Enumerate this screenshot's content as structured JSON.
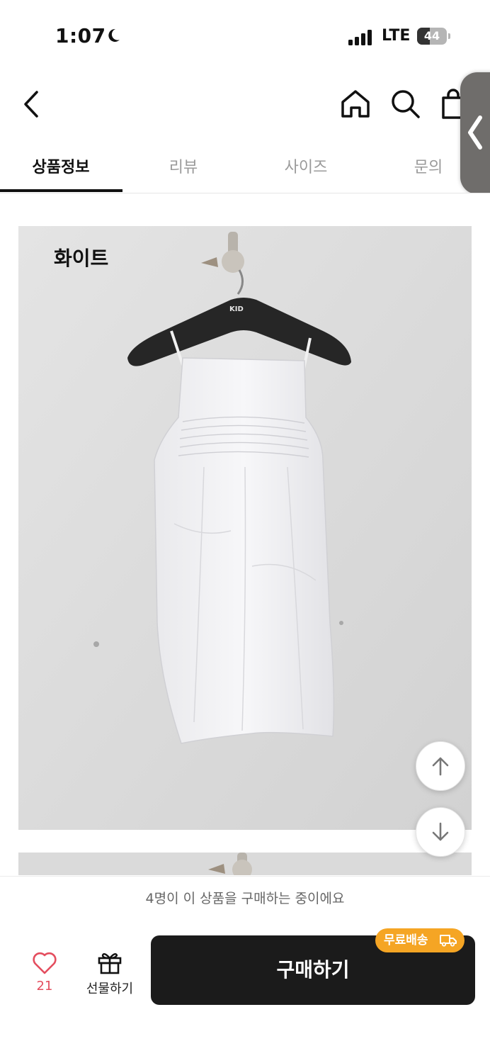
{
  "status_bar": {
    "time": "1:07",
    "network": "LTE",
    "battery": "44",
    "battery_level": 0.44
  },
  "nav": {
    "icons": [
      "back-icon",
      "home-icon",
      "search-icon",
      "shopping-bag-icon"
    ]
  },
  "side_handle": {
    "icon": "chevron-left-icon"
  },
  "tabs": [
    {
      "label": "상품정보",
      "active": true
    },
    {
      "label": "리뷰",
      "active": false
    },
    {
      "label": "사이즈",
      "active": false
    },
    {
      "label": "문의",
      "active": false
    }
  ],
  "product_images": [
    {
      "label": "화이트",
      "hanger_brand": "KID"
    }
  ],
  "scroll_buttons": {
    "up": "arrow-up-icon",
    "down": "arrow-down-icon"
  },
  "notice": "4명이 이 상품을 구매하는 중이에요",
  "bottom_bar": {
    "like_count": "21",
    "gift_label": "선물하기",
    "buy_label": "구매하기",
    "free_shipping_badge": "무료배송"
  },
  "colors": {
    "accent_orange": "#f5a524",
    "heart_red": "#e44d5e",
    "buy_button": "#1b1b1b"
  }
}
